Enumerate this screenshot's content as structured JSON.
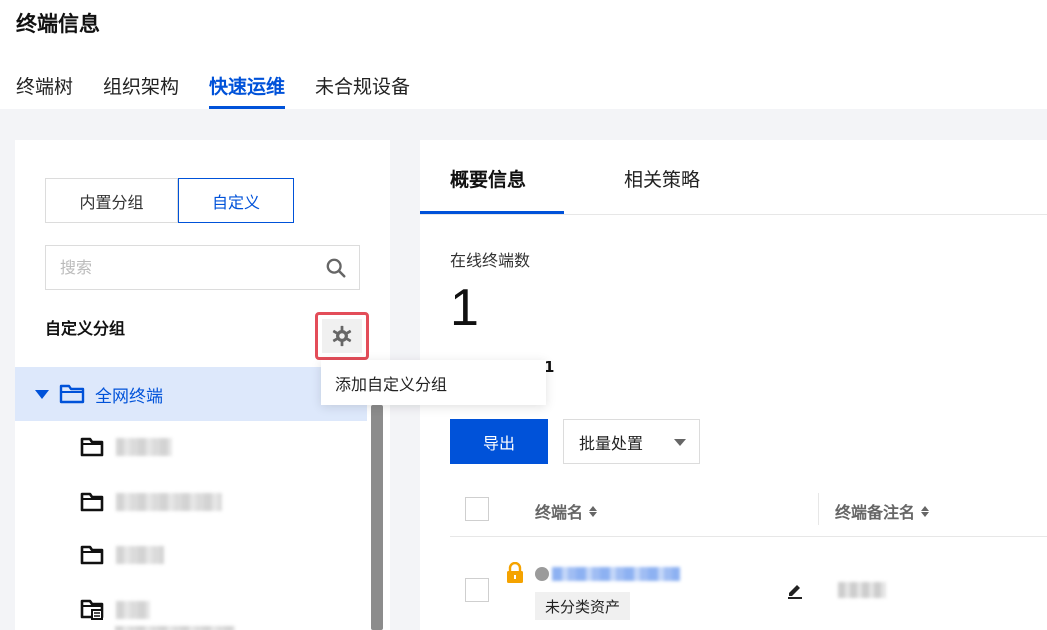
{
  "page": {
    "title": "终端信息"
  },
  "top_tabs": [
    {
      "label": "终端树"
    },
    {
      "label": "组织架构"
    },
    {
      "label": "快速运维",
      "active": true
    },
    {
      "label": "未合规设备"
    }
  ],
  "left": {
    "segments": {
      "builtin": "内置分组",
      "custom": "自定义"
    },
    "search": {
      "placeholder": "搜索",
      "value": ""
    },
    "group_title": "自定义分组",
    "tooltip": "添加自定义分组",
    "tree": {
      "root_label": "全网终端",
      "children": [
        {
          "icon": "folder-icon"
        },
        {
          "icon": "folder-icon"
        },
        {
          "icon": "folder-icon"
        },
        {
          "icon": "folder-shared-icon"
        }
      ]
    }
  },
  "right": {
    "tabs": {
      "overview": "概要信息",
      "policies": "相关策略"
    },
    "online_label": "在线终端数",
    "online_count": "1",
    "sub_stat_value": "1",
    "export_label": "导出",
    "batch_label": "批量处置",
    "table": {
      "col_name": "终端名",
      "col_remark": "终端备注名",
      "rows": [
        {
          "tag": "未分类资产"
        }
      ]
    }
  },
  "colors": {
    "accent": "#0052d9",
    "highlight": "#e34d59",
    "lock": "#f5a300"
  }
}
